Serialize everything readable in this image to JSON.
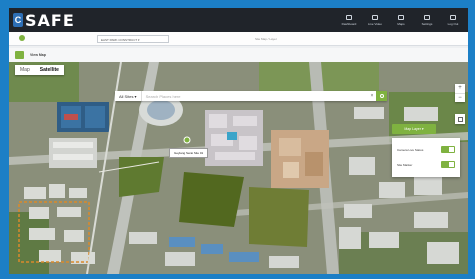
{
  "header": {
    "logo_mark": "C",
    "logo_text": "SAFE",
    "nav": [
      {
        "name": "nav-dashboard",
        "label": "Dashboard",
        "icon": "monitor-icon"
      },
      {
        "name": "nav-live-video",
        "label": "Live Video",
        "icon": "video-icon"
      },
      {
        "name": "nav-maps",
        "label": "Maps",
        "icon": "map-icon"
      },
      {
        "name": "nav-settings",
        "label": "Settings",
        "icon": "gear-icon"
      },
      {
        "name": "nav-log-out",
        "label": "Log Out",
        "icon": "logout-icon"
      }
    ]
  },
  "subheader": {
    "site_select": "EAST PARK CONSTRUCT ▾",
    "caption": "Site Map / Layer"
  },
  "toolbar": {
    "title": "View Map"
  },
  "map": {
    "type_options": [
      "Map",
      "Satellite"
    ],
    "active_type": "Satellite",
    "search_scope": "All Sites ▾",
    "search_placeholder": "Search Places here",
    "search_clear": "×",
    "zoom_in": "+",
    "zoom_out": "−",
    "pin_label": "Geylang Serai Site 01",
    "layer_toggle_label": "Map Layer ▾",
    "layers": [
      {
        "name": "layer-camera-status",
        "label": "Camera Live Status",
        "on": true
      },
      {
        "name": "layer-site-marker",
        "label": "Site Marker",
        "on": true
      }
    ]
  },
  "colors": {
    "accent": "#7fb240",
    "topbar": "#20242a",
    "brand": "#1c7fc6"
  }
}
